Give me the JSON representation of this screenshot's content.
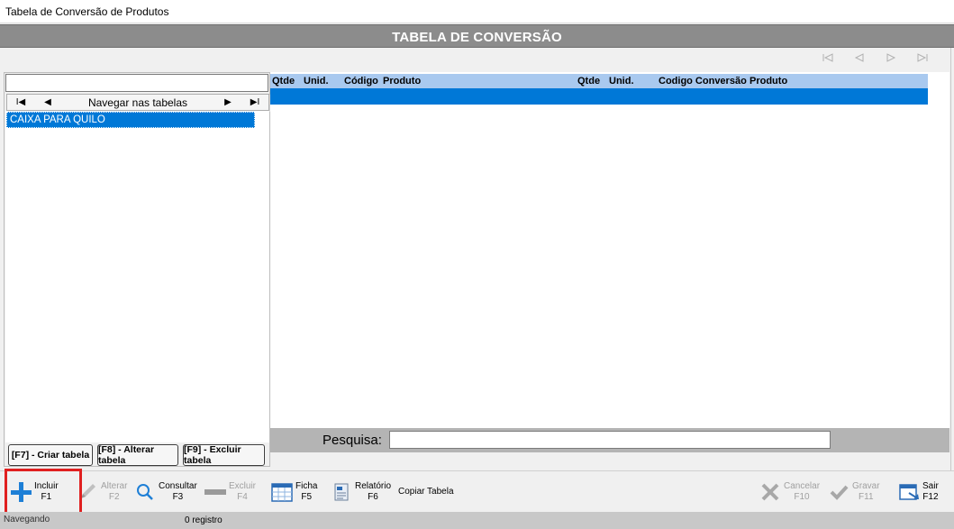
{
  "window": {
    "title": "Tabela de Conversão de Produtos"
  },
  "header": {
    "title": "TABELA DE CONVERSÃO"
  },
  "left_panel": {
    "filter_value": "",
    "navigator": {
      "first": "I◀",
      "prev": "◀",
      "label": "Navegar nas tabelas",
      "next": "▶",
      "last": "▶I"
    },
    "tables": [
      {
        "label": "CAIXA PARA QUILO",
        "selected": true
      }
    ],
    "buttons": {
      "create": "[F7] - Criar tabela",
      "edit": "[F8] - Alterar tabela",
      "delete": "[F9] - Excluir tabela"
    }
  },
  "grid": {
    "columns": [
      "Qtde",
      "Unid.",
      "Código",
      "Produto",
      "Qtde",
      "Unid.",
      "Codigo Conversão",
      "Produto"
    ],
    "rows": []
  },
  "search": {
    "label": "Pesquisa:",
    "value": ""
  },
  "toolbar": {
    "include": {
      "label": "Incluir",
      "key": "F1"
    },
    "alter": {
      "label": "Alterar",
      "key": "F2"
    },
    "consult": {
      "label": "Consultar",
      "key": "F3"
    },
    "delete": {
      "label": "Excluir",
      "key": "F4"
    },
    "sheet": {
      "label": "Ficha",
      "key": "F5"
    },
    "report": {
      "label": "Relatório",
      "key": "F6"
    },
    "copy": {
      "label": "Copiar Tabela"
    },
    "cancel": {
      "label": "Cancelar",
      "key": "F10"
    },
    "save": {
      "label": "Gravar",
      "key": "F11"
    },
    "exit": {
      "label": "Sair",
      "key": "F12"
    }
  },
  "status": {
    "mode": "Navegando",
    "count": "0 registro"
  },
  "colors": {
    "accent": "#0078d7",
    "header_band": "#8c8c8c",
    "grid_header": "#a9c9ef",
    "highlight": "#e02020",
    "include_icon": "#1e7fd6"
  }
}
